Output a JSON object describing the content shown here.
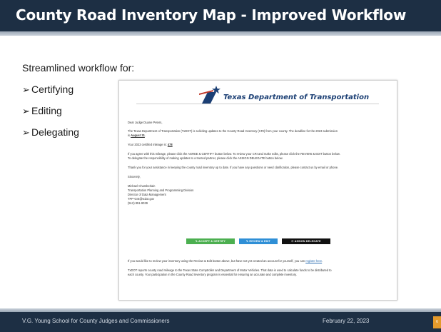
{
  "slide": {
    "title": "County Road Inventory Map - Improved Workflow",
    "intro": "Streamlined workflow for:",
    "bullets": [
      "Certifying",
      "Editing",
      "Delegating"
    ],
    "bullet_glyph": "➢"
  },
  "email": {
    "logo_text": "Texas Department of Transportation",
    "greeting": "Dear Judge Duane Peters,",
    "para1_line1": "The Texas Department of Transportation (TxDOT) is soliciting updates to the County Road Inventory (CRI) from your county. The deadline for the 2023 submission",
    "para1_line2_prefix": "is ",
    "deadline": "August 31",
    "para1_line2_suffix": ".",
    "mileage_prefix": "Your 2023 certified mileage is: ",
    "mileage_value": "478",
    "para3_line1": "If you agree with this mileage, please click the AGREE & CERTIFY button below. To review your CRI and make edits, please click the REVIEW & EDIT button below.",
    "para3_line2": "To delegate the responsibility of making updates to a trusted partner, please click the ASSIGN DELEGATE button below.",
    "thanks": "Thank you for your assistance in keeping the county road inventory up to date. If you have any questions or need clarification, please contact us by email or phone.",
    "closing": "Sincerely,",
    "sig_name": "Michael Chamberlain",
    "sig_division": "Transportation Planning and Programming Division",
    "sig_title": "Director of Data Management",
    "sig_email": "TPP-GIS@txdot.gov",
    "sig_phone": "(512) 851-9039",
    "buttons": {
      "accept": "ACCEPT & CERTIFY",
      "review": "REVIEW & EDIT",
      "delegate": "ASSIGN DELEGATE"
    },
    "register_prefix": "If you would like to review your inventory using the Review & Edit button above, but have not yet created an account for yourself, you can ",
    "register_link": "register here",
    "register_suffix": ".",
    "report_line1": "TxDOT reports county road mileage to the Texas State Comptroller and Department of Motor Vehicles. That data is used to calculate funds to be distributed to",
    "report_line2": "each county. Your participation in the County Road Inventory program is essential for ensuring an accurate and complete inventory."
  },
  "footer": {
    "left": "V.G. Young School for County Judges and Commissioners",
    "right": "February 22, 2023",
    "slide_number": "6"
  },
  "colors": {
    "title_bar": "#1d2f44",
    "accept": "#4caf50",
    "review": "#2f8fd6",
    "delegate": "#111111",
    "badge": "#e39a2c"
  }
}
